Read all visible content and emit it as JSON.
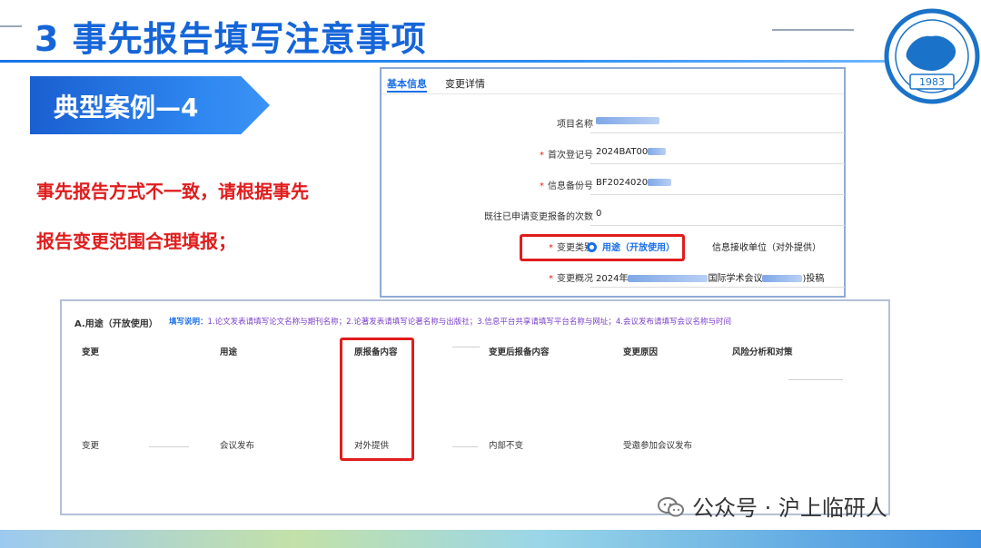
{
  "slide": {
    "title": "3  事先报告填写注意事项",
    "logo_year": "1983",
    "case_label": "典型案例—4",
    "note_line1": "事先报告方式不一致，请根据事先",
    "note_line2": "报告变更范围合理填报；"
  },
  "form": {
    "tabs": [
      "基本信息",
      "变更详情"
    ],
    "fields": {
      "project_name_label": "项目名称",
      "first_reg_label": "首次登记号",
      "first_reg_value": "2024BAT00",
      "filing_no_label": "信息备份号",
      "filing_no_value": "BF2024020",
      "prior_count_label": "既往已申请变更报备的次数",
      "prior_count_value": "0",
      "change_type_label": "变更类别",
      "change_type_option_selected": "用途（开放使用）",
      "change_type_option_other": "信息接收单位（对外提供）",
      "summary_label": "变更概况",
      "summary_value_start": "2024年",
      "summary_value_mid": "国际学术会议",
      "summary_value_end": ")投稿"
    }
  },
  "table": {
    "title": "A.用途（开放使用）",
    "note_prefix": "填写说明：",
    "note": "1.论文发表请填写论文名称与期刊名称；2.论著发表请填写论著名称与出版社；3.信息平台共享请填写平台名称与网址；4.会议发布请填写会议名称与时间",
    "headers": [
      "变更",
      "用途",
      "原报备内容",
      "变更后报备内容",
      "变更原因",
      "风险分析和对策"
    ],
    "row": [
      "变更",
      "会议发布",
      "对外提供",
      "内部不变",
      "受邀参加会议发布"
    ]
  },
  "watermark": {
    "text": "公众号 · 沪上临研人"
  },
  "colors": {
    "title_blue": "#1565d8",
    "alert_red": "#e01d1d",
    "link_blue": "#1a6fe8"
  }
}
